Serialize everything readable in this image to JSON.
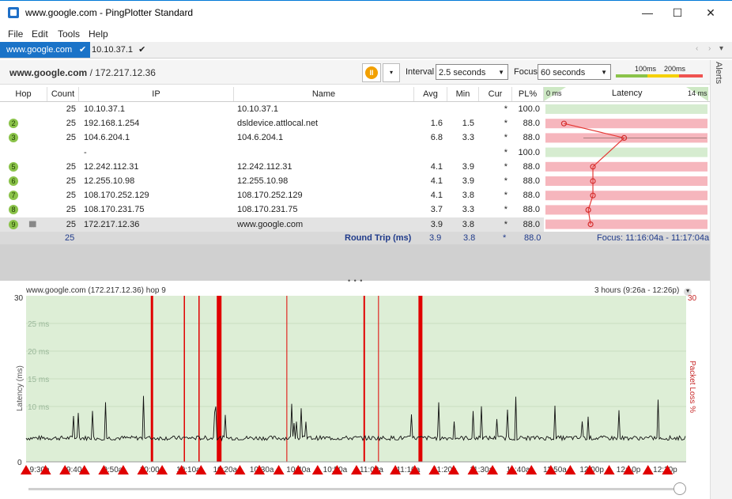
{
  "window": {
    "title": "www.google.com - PingPlotter Standard",
    "controls": {
      "minimize": "—",
      "maximize": "☐",
      "close": "✕"
    }
  },
  "menu": [
    "File",
    "Edit",
    "Tools",
    "Help"
  ],
  "tabs": [
    {
      "label": "www.google.com",
      "check": "✔",
      "active": true
    },
    {
      "label": "10.10.37.1",
      "check": "✔",
      "active": false
    }
  ],
  "tab_scroll": {
    "left": "‹",
    "right": "›",
    "down": "▾"
  },
  "toolbar": {
    "target_name": "www.google.com",
    "target_ip": " / 172.217.12.36",
    "pause_icon": "II",
    "dropdown_icon": "▾",
    "interval_label": "Interval",
    "interval_value": "2.5 seconds",
    "focus_label": "Focus",
    "focus_value": "60 seconds",
    "scale_100": "100ms",
    "scale_200": "200ms"
  },
  "alerts_label": "Alerts",
  "table": {
    "headers": {
      "hop": "Hop",
      "count": "Count",
      "ip": "IP",
      "name": "Name",
      "avg": "Avg",
      "min": "Min",
      "cur": "Cur",
      "pl": "PL%",
      "lat_min": "0 ms",
      "latency": "Latency",
      "lat_max": "14 ms"
    },
    "rows": [
      {
        "hop": "",
        "count": "25",
        "ip": "10.10.37.1",
        "name": "10.10.37.1",
        "avg": "",
        "min": "",
        "cur": "*",
        "pl": "100.0",
        "plot": null
      },
      {
        "hop": "2",
        "count": "25",
        "ip": "192.168.1.254",
        "name": "dsldevice.attlocal.net",
        "avg": "1.6",
        "min": "1.5",
        "cur": "*",
        "pl": "88.0",
        "plot": 1.6
      },
      {
        "hop": "3",
        "count": "25",
        "ip": "104.6.204.1",
        "name": "104.6.204.1",
        "avg": "6.8",
        "min": "3.3",
        "cur": "*",
        "pl": "88.0",
        "plot": 6.8
      },
      {
        "hop": "",
        "count": "",
        "ip": "-",
        "name": "",
        "avg": "",
        "min": "",
        "cur": "*",
        "pl": "100.0",
        "plot": null
      },
      {
        "hop": "5",
        "count": "25",
        "ip": "12.242.112.31",
        "name": "12.242.112.31",
        "avg": "4.1",
        "min": "3.9",
        "cur": "*",
        "pl": "88.0",
        "plot": 4.1
      },
      {
        "hop": "6",
        "count": "25",
        "ip": "12.255.10.98",
        "name": "12.255.10.98",
        "avg": "4.1",
        "min": "3.9",
        "cur": "*",
        "pl": "88.0",
        "plot": 4.1
      },
      {
        "hop": "7",
        "count": "25",
        "ip": "108.170.252.129",
        "name": "108.170.252.129",
        "avg": "4.1",
        "min": "3.8",
        "cur": "*",
        "pl": "88.0",
        "plot": 4.1
      },
      {
        "hop": "8",
        "count": "25",
        "ip": "108.170.231.75",
        "name": "108.170.231.75",
        "avg": "3.7",
        "min": "3.3",
        "cur": "*",
        "pl": "88.0",
        "plot": 3.7
      },
      {
        "hop": "9",
        "count": "25",
        "ip": "172.217.12.36",
        "name": "www.google.com",
        "avg": "3.9",
        "min": "3.8",
        "cur": "*",
        "pl": "88.0",
        "plot": 3.9
      }
    ],
    "summary": {
      "count": "25",
      "label": "Round Trip (ms)",
      "avg": "3.9",
      "min": "3.8",
      "cur": "*",
      "pl": "88.0",
      "focus": "Focus: 11:16:04a - 11:17:04a"
    }
  },
  "splitter": "• • •",
  "graph": {
    "title": "www.google.com (172.217.12.36) hop 9",
    "range_label": "3 hours (9:26a - 12:26p)",
    "y_label": "Latency (ms)",
    "y2_label": "Packet Loss %",
    "y_top": "30",
    "y_bottom": "0",
    "y2_top": "30",
    "grid_labels": [
      "25 ms",
      "20 ms",
      "15 ms",
      "10 ms"
    ],
    "time_labels": [
      "9:30a",
      "9:40a",
      "9:50a",
      "10:00a",
      "10:10a",
      "10:20a",
      "10:30a",
      "10:40a",
      "10:50a",
      "11:00a",
      "11:10a",
      "11:20a",
      "11:30a",
      "11:40a",
      "11:50a",
      "12:00p",
      "12:10p",
      "12:20p"
    ]
  },
  "colors": {
    "accent": "#1a73c8",
    "hop_badge": "#8bc34a",
    "latency_bg_loss": "#f6b6bd",
    "latency_bg_ok": "#d6ecd0",
    "graph_bg": "#ddeed6",
    "loss_bar": "#e00000",
    "trace": "#111111"
  }
}
